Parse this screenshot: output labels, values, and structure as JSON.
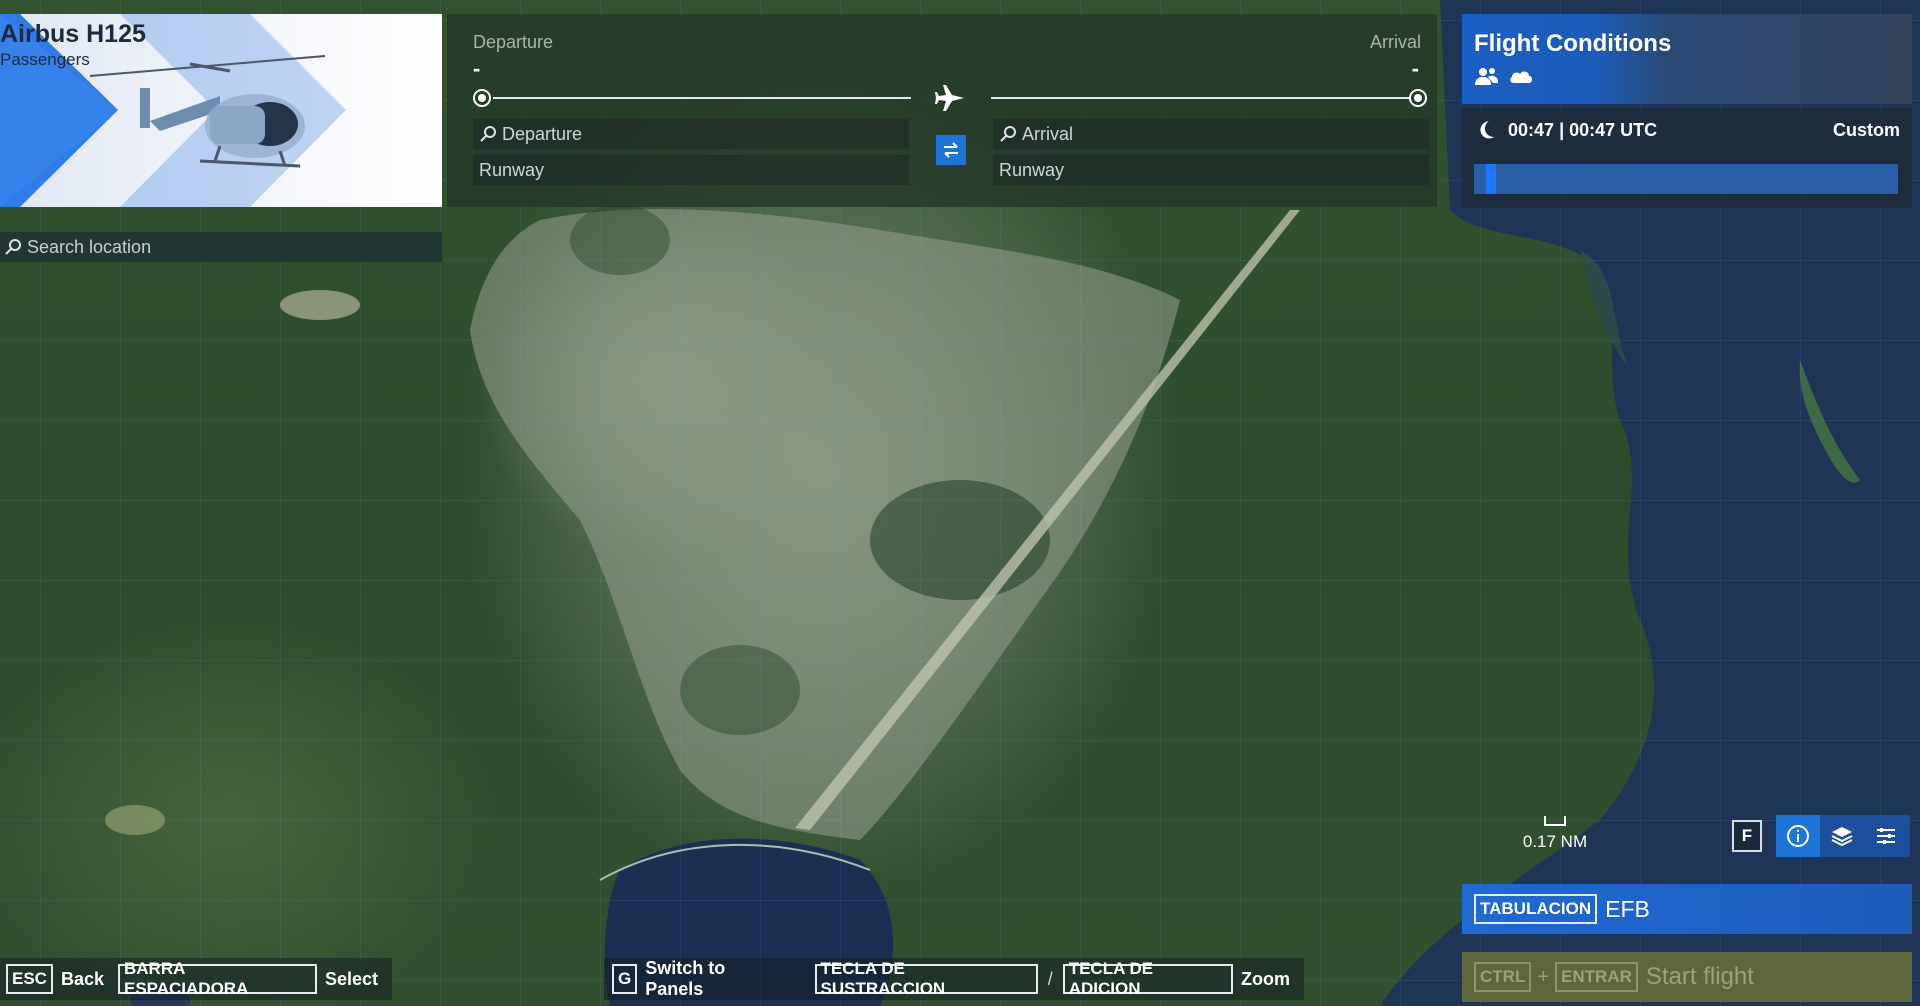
{
  "aircraft": {
    "name": "Airbus H125",
    "subtitle": "Passengers"
  },
  "search": {
    "placeholder": "Search location"
  },
  "route": {
    "departure_label": "Departure",
    "arrival_label": "Arrival",
    "departure_value": "-",
    "arrival_value": "-",
    "departure_search_placeholder": "Departure",
    "arrival_search_placeholder": "Arrival",
    "departure_runway": "Runway",
    "arrival_runway": "Runway"
  },
  "flight_conditions": {
    "title": "Flight Conditions",
    "time_local": "00:47",
    "separator": "|",
    "time_utc": "00:47 UTC",
    "mode": "Custom",
    "time_of_day_fraction": 0.03
  },
  "map": {
    "scale_label": "0.17 NM",
    "filter_key": "F"
  },
  "efb": {
    "key": "TABULACION",
    "label": "EFB"
  },
  "start_flight": {
    "key1": "CTRL",
    "plus": "+",
    "key2": "ENTRAR",
    "label": "Start flight"
  },
  "hints": {
    "back_key": "ESC",
    "back_label": "Back",
    "select_key": "BARRA ESPACIADORA",
    "select_label": "Select",
    "panels_key": "G",
    "panels_label": "Switch to Panels",
    "zoom_out_key": "TECLA DE SUSTRACCION",
    "zoom_sep": "/",
    "zoom_in_key": "TECLA DE ADICION",
    "zoom_label": "Zoom"
  },
  "colors": {
    "accent_blue": "#1f74d8",
    "start_flight_bg": "#696e32"
  }
}
